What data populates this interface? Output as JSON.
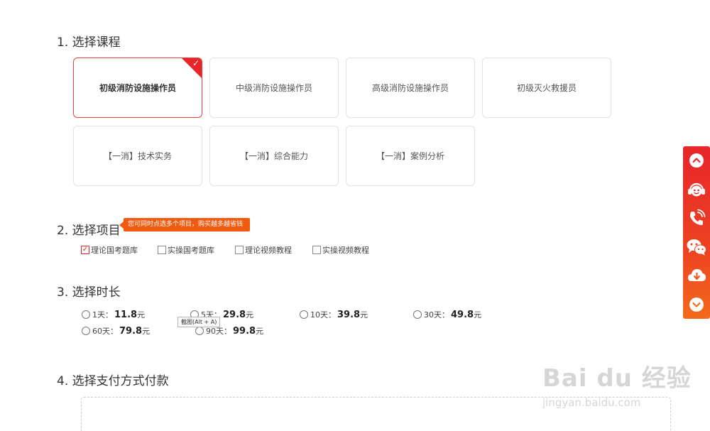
{
  "sections": {
    "course_title": "1. 选择课程",
    "item_title": "2. 选择项目",
    "duration_title": "3. 选择时长",
    "payment_title": "4. 选择支付方式付款"
  },
  "courses": [
    {
      "label": "初级消防设施操作员",
      "selected": true
    },
    {
      "label": "中级消防设施操作员",
      "selected": false
    },
    {
      "label": "高级消防设施操作员",
      "selected": false
    },
    {
      "label": "初级灭火救援员",
      "selected": false
    },
    {
      "label": "【一消】技术实务",
      "selected": false
    },
    {
      "label": "【一消】综合能力",
      "selected": false
    },
    {
      "label": "【一消】案例分析",
      "selected": false
    }
  ],
  "item_tip": "您可同时点选多个项目，购买越多越省钱",
  "items": [
    {
      "label": "理论国考题库",
      "checked": true
    },
    {
      "label": "实操国考题库",
      "checked": false
    },
    {
      "label": "理论视频教程",
      "checked": false
    },
    {
      "label": "实操视频教程",
      "checked": false
    }
  ],
  "durations": [
    {
      "label": "1天：",
      "price": "11.8",
      "unit": "元"
    },
    {
      "label": "5天：",
      "price": "29.8",
      "unit": "元"
    },
    {
      "label": "10天：",
      "price": "39.8",
      "unit": "元"
    },
    {
      "label": "30天：",
      "price": "49.8",
      "unit": "元"
    },
    {
      "label": "60天：",
      "price": "79.8",
      "unit": "元"
    },
    {
      "label": "90天：",
      "price": "99.8",
      "unit": "元"
    }
  ],
  "screenshot_tooltip": "截图(Alt + A)",
  "side_bar": {
    "color": "#e8252a",
    "bottom_color": "#f36a1c",
    "buttons": [
      "chevron-up-icon",
      "customer-service-icon",
      "phone-icon",
      "wechat-icon",
      "download-icon",
      "chevron-down-icon"
    ]
  },
  "watermark": {
    "main": "Bai du 经验",
    "sub": "jingyan.baidu.com"
  }
}
